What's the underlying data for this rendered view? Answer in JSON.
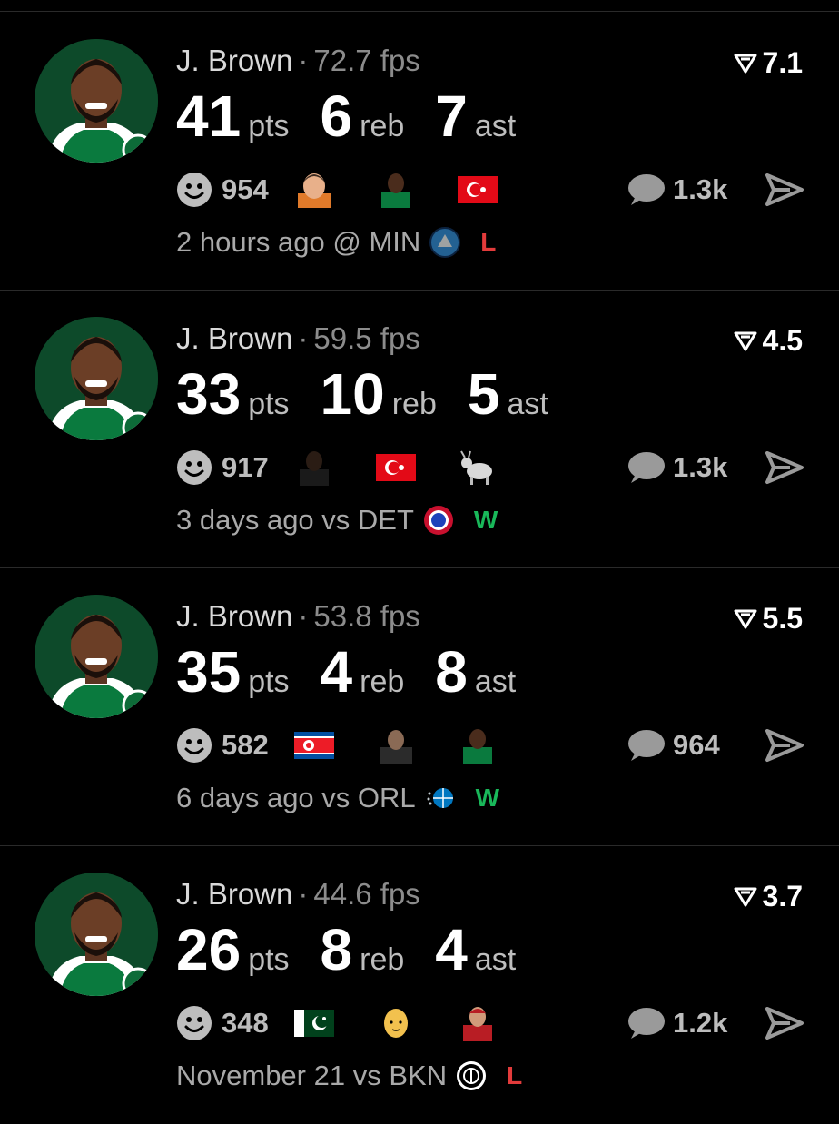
{
  "feed": [
    {
      "name": "J. Brown",
      "fps": "72.7 fps",
      "rating": "7.1",
      "pts": "41",
      "reb": "6",
      "ast": "7",
      "reactions": "954",
      "emojis": [
        "face-emoji",
        "celtics-player-emoji",
        "turkey-flag-emoji"
      ],
      "comments": "1.3k",
      "when": "2 hours ago",
      "venue": "@",
      "opponent": "MIN",
      "opponent_logo": "timberwolves-logo",
      "result": "L"
    },
    {
      "name": "J. Brown",
      "fps": "59.5 fps",
      "rating": "4.5",
      "pts": "33",
      "reb": "10",
      "ast": "5",
      "reactions": "917",
      "emojis": [
        "nets-player-emoji",
        "turkey-flag-emoji",
        "goat-emoji"
      ],
      "comments": "1.3k",
      "when": "3 days ago",
      "venue": "vs",
      "opponent": "DET",
      "opponent_logo": "pistons-logo",
      "result": "W"
    },
    {
      "name": "J. Brown",
      "fps": "53.8 fps",
      "rating": "5.5",
      "pts": "35",
      "reb": "4",
      "ast": "8",
      "reactions": "582",
      "emojis": [
        "north-korea-flag-emoji",
        "person-emoji",
        "celtics-player-emoji"
      ],
      "comments": "964",
      "when": "6 days ago",
      "venue": "vs",
      "opponent": "ORL",
      "opponent_logo": "magic-logo",
      "result": "W"
    },
    {
      "name": "J. Brown",
      "fps": "44.6 fps",
      "rating": "3.7",
      "pts": "26",
      "reb": "8",
      "ast": "4",
      "reactions": "348",
      "emojis": [
        "pakistan-flag-emoji",
        "bald-face-emoji",
        "red-player-emoji"
      ],
      "comments": "1.2k",
      "when": "November 21",
      "venue": "vs",
      "opponent": "BKN",
      "opponent_logo": "nets-logo",
      "result": "L"
    }
  ],
  "units": {
    "pts": "pts",
    "reb": "reb",
    "ast": "ast"
  },
  "separator": "·",
  "colors": {
    "background": "#000000",
    "win": "#19b85a",
    "loss": "#e23b3b",
    "muted": "#a9a9a9"
  }
}
